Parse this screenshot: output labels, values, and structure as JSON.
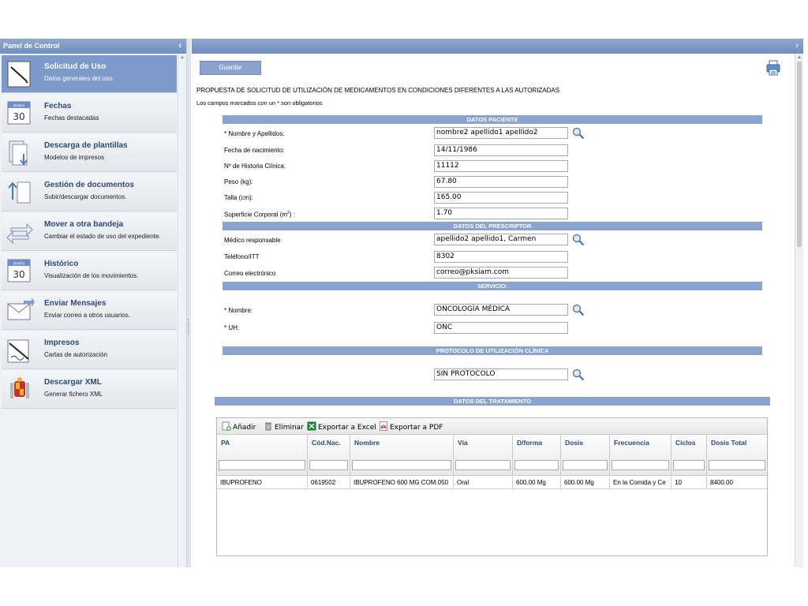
{
  "left_panel": {
    "title": "Panel de Control",
    "items": [
      {
        "title": "Solicitud de Uso",
        "sub": "Datos generales del uso.",
        "icon": "pen-document-icon",
        "active": true
      },
      {
        "title": "Fechas",
        "sub": "Fechas destacadas",
        "icon": "calendar-icon",
        "active": false
      },
      {
        "title": "Descarga de plantillas",
        "sub": "Modelos de impresos",
        "icon": "download-template-icon",
        "active": false
      },
      {
        "title": "Gestión de documentos",
        "sub": "Subir/descargar documentos.",
        "icon": "upload-documents-icon",
        "active": false
      },
      {
        "title": "Mover a otra bandeja",
        "sub": "Cambiar el estado de uso del expediente.",
        "icon": "move-arrows-icon",
        "active": false
      },
      {
        "title": "Histórico",
        "sub": "Visualización de los movimientos.",
        "icon": "calendar-history-icon",
        "active": false
      },
      {
        "title": "Enviar Mensajes",
        "sub": "Enviar correo a otros usuarios.",
        "icon": "envelope-icon",
        "active": false
      },
      {
        "title": "Impresos",
        "sub": "Cartas de autorización",
        "icon": "signature-document-icon",
        "active": false
      },
      {
        "title": "Descargar XML",
        "sub": "Generar fichero XML",
        "icon": "coat-of-arms-icon",
        "active": false
      }
    ],
    "calendar_day": "30",
    "calendar_month": "enero"
  },
  "toolbar": {
    "save_label": "Guardar"
  },
  "form": {
    "heading": "PROPUESTA DE SOLICITUD DE UTILIZACIÓN DE MEDICAMENTOS EN CONDICIONES DIFERENTES A LAS AUTORIZADAS",
    "required_note": "Los campos marcados con un * son obligatorios",
    "sections": {
      "paciente": "DATOS PACIENTE",
      "prescriptor": "DATOS DEL PRESCRIPTOR",
      "servicio": "SERVICIO:",
      "protocolo": "PROTOCOLO DE UTILIZACIÓN CLÍNICA",
      "tratamiento": "DATOS DEL TRATAMIENTO"
    },
    "paciente": {
      "nombre_label": "* Nombre y Apellidos:",
      "nombre_value": "nombre2 apellido1 apellido2",
      "fecha_label": "Fecha de nacimiento:",
      "fecha_value": "14/11/1986",
      "historia_label": "Nº de Historia Clínica:",
      "historia_value": "11112",
      "peso_label": "Peso (kg):",
      "peso_value": "67.80",
      "talla_label": "Talla (cm):",
      "talla_value": "165.00",
      "superficie_label": "Superficie Corporal (m",
      "superficie_sup": "2",
      "superficie_suffix": ") :",
      "superficie_value": "1.70"
    },
    "prescriptor": {
      "medico_label": "Médico responsable",
      "medico_value": "apellido2 apellido1, Carmen",
      "telefono_label": "Teléfono/ITT",
      "telefono_value": "8302",
      "correo_label": "Correo electrónico",
      "correo_value": "correo@pksiam.com"
    },
    "servicio": {
      "nombre_label": "* Nombre:",
      "nombre_value": "ONCOLOGÍA MÉDICA",
      "uh_label": "* UH:",
      "uh_value": "ONC"
    },
    "protocolo": {
      "value": "SIN PROTOCOLO"
    }
  },
  "grid": {
    "toolbar": {
      "add": "Añadir",
      "delete": "Eliminar",
      "excel": "Exportar a Excel",
      "pdf": "Exportar a PDF"
    },
    "columns": [
      "PA",
      "Cód.Nac.",
      "Nombre",
      "Vía",
      "D/forma",
      "Dosis",
      "Frecuencia",
      "Ciclos",
      "Dosis Total"
    ],
    "rows": [
      [
        "IBUPROFENO",
        "0619502",
        "IBUPROFENO 600 MG COM.050",
        "Oral",
        "600.00 Mg",
        "600.00 Mg",
        "En la Comida y Ce",
        "10",
        "8400.00"
      ]
    ]
  }
}
